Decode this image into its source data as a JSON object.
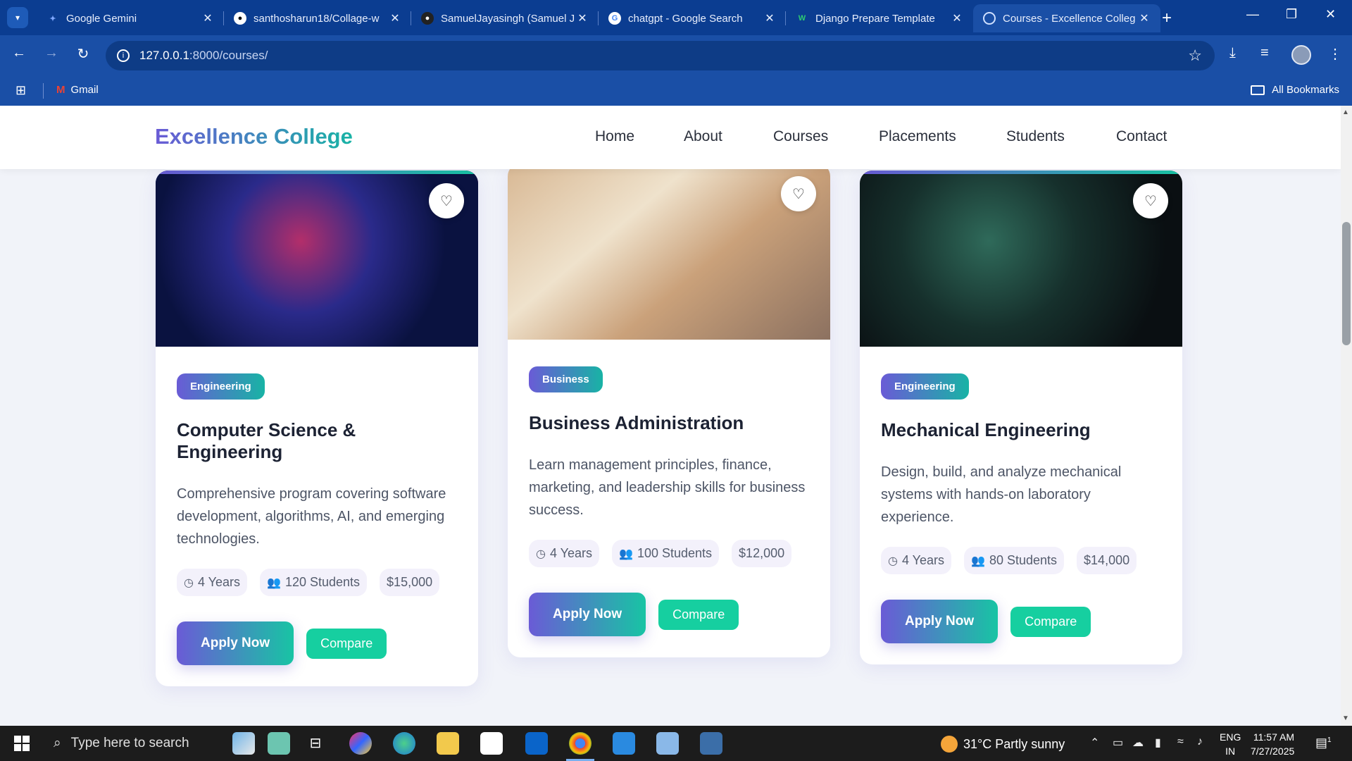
{
  "browser": {
    "tabs": [
      {
        "title": "Google Gemini",
        "icon": "gemini-icon",
        "active": false
      },
      {
        "title": "santhosharun18/Collage-w",
        "icon": "github-icon",
        "active": false
      },
      {
        "title": "SamuelJayasingh (Samuel J",
        "icon": "github-icon",
        "active": false
      },
      {
        "title": "chatgpt - Google Search",
        "icon": "google-icon",
        "active": false
      },
      {
        "title": "Django Prepare Template",
        "icon": "w-icon",
        "active": false
      },
      {
        "title": "Courses - Excellence Colleg",
        "icon": "globe-icon",
        "active": true
      }
    ],
    "url_host": "127.0.0.1",
    "url_path": ":8000/courses/",
    "bookmarks": {
      "gmail": "Gmail",
      "all": "All Bookmarks"
    }
  },
  "site": {
    "logo": "Excellence College",
    "nav": [
      "Home",
      "About",
      "Courses",
      "Placements",
      "Students",
      "Contact"
    ]
  },
  "courses": [
    {
      "category": "Engineering",
      "title": "Computer Science & Engineering",
      "description": "Comprehensive program covering software development, algorithms, AI, and emerging technologies.",
      "duration": "4 Years",
      "students": "120 Students",
      "fee": "$15,000",
      "apply": "Apply Now",
      "compare": "Compare"
    },
    {
      "category": "Business",
      "title": "Business Administration",
      "description": "Learn management principles, finance, marketing, and leadership skills for business success.",
      "duration": "4 Years",
      "students": "100 Students",
      "fee": "$12,000",
      "apply": "Apply Now",
      "compare": "Compare"
    },
    {
      "category": "Engineering",
      "title": "Mechanical Engineering",
      "description": "Design, build, and analyze mechanical systems with hands-on laboratory experience.",
      "duration": "4 Years",
      "students": "80 Students",
      "fee": "$14,000",
      "apply": "Apply Now",
      "compare": "Compare"
    }
  ],
  "taskbar": {
    "search_placeholder": "Type here to search",
    "weather": "31°C  Partly sunny",
    "lang_1": "ENG",
    "lang_2": "IN",
    "time": "11:57 AM",
    "date": "7/27/2025",
    "notification_count": "1"
  },
  "colors": {
    "accent_start": "#6a5bd6",
    "accent_end": "#18b3a5",
    "compare": "#16cfa0",
    "chrome": "#1a4fa6"
  }
}
